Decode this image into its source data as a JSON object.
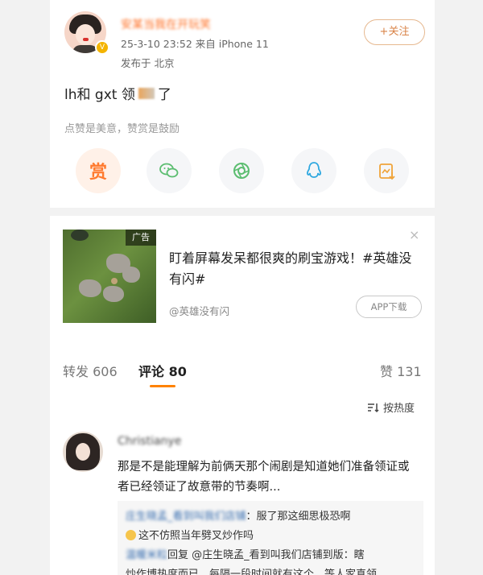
{
  "post": {
    "username": "安某当我在开玩笑",
    "meta": "25-3-10 23:52  来自 iPhone 11",
    "location": "发布于 北京",
    "follow_label": "+关注",
    "text_before": "lh和 gxt 领",
    "text_after": "了",
    "hint": "点赞是美意，赞赏是鼓励",
    "reward_label": "赏",
    "share_icons": [
      "reward-icon",
      "wechat-icon",
      "moments-icon",
      "qq-icon",
      "save-image-icon"
    ]
  },
  "ad": {
    "tag": "广告",
    "title": "盯着屏幕发呆都很爽的刷宝游戏！#英雄没有闪#",
    "source": "@英雄没有闪",
    "button": "APP下载",
    "close": "×"
  },
  "tabs": {
    "repost": "转发 606",
    "comment": "评论 80",
    "like": "赞 131",
    "sort": "按热度"
  },
  "comment": {
    "username": "Christianye",
    "text": "那是不是能理解为前俩天那个闹剧是知道她们准备领证或者已经领证了故意带的节奏啊...",
    "replies": [
      {
        "user": "庄生晓孟_看到叫我们店铺",
        "text": "：服了那这细思极恐啊"
      },
      {
        "user": "",
        "text": "这不仿照当年劈叉炒作吗"
      },
      {
        "user": "温暖米粒",
        "text": "回复 @庄生晓孟_看到叫我们店铺到版：瞎"
      },
      {
        "user": "",
        "text": "炒作博热度而已，每隔一段时间就有这个，等人家真领"
      }
    ]
  },
  "colors": {
    "accent": "#ff8200",
    "follow": "#d98347",
    "link": "#3a6fb0"
  }
}
